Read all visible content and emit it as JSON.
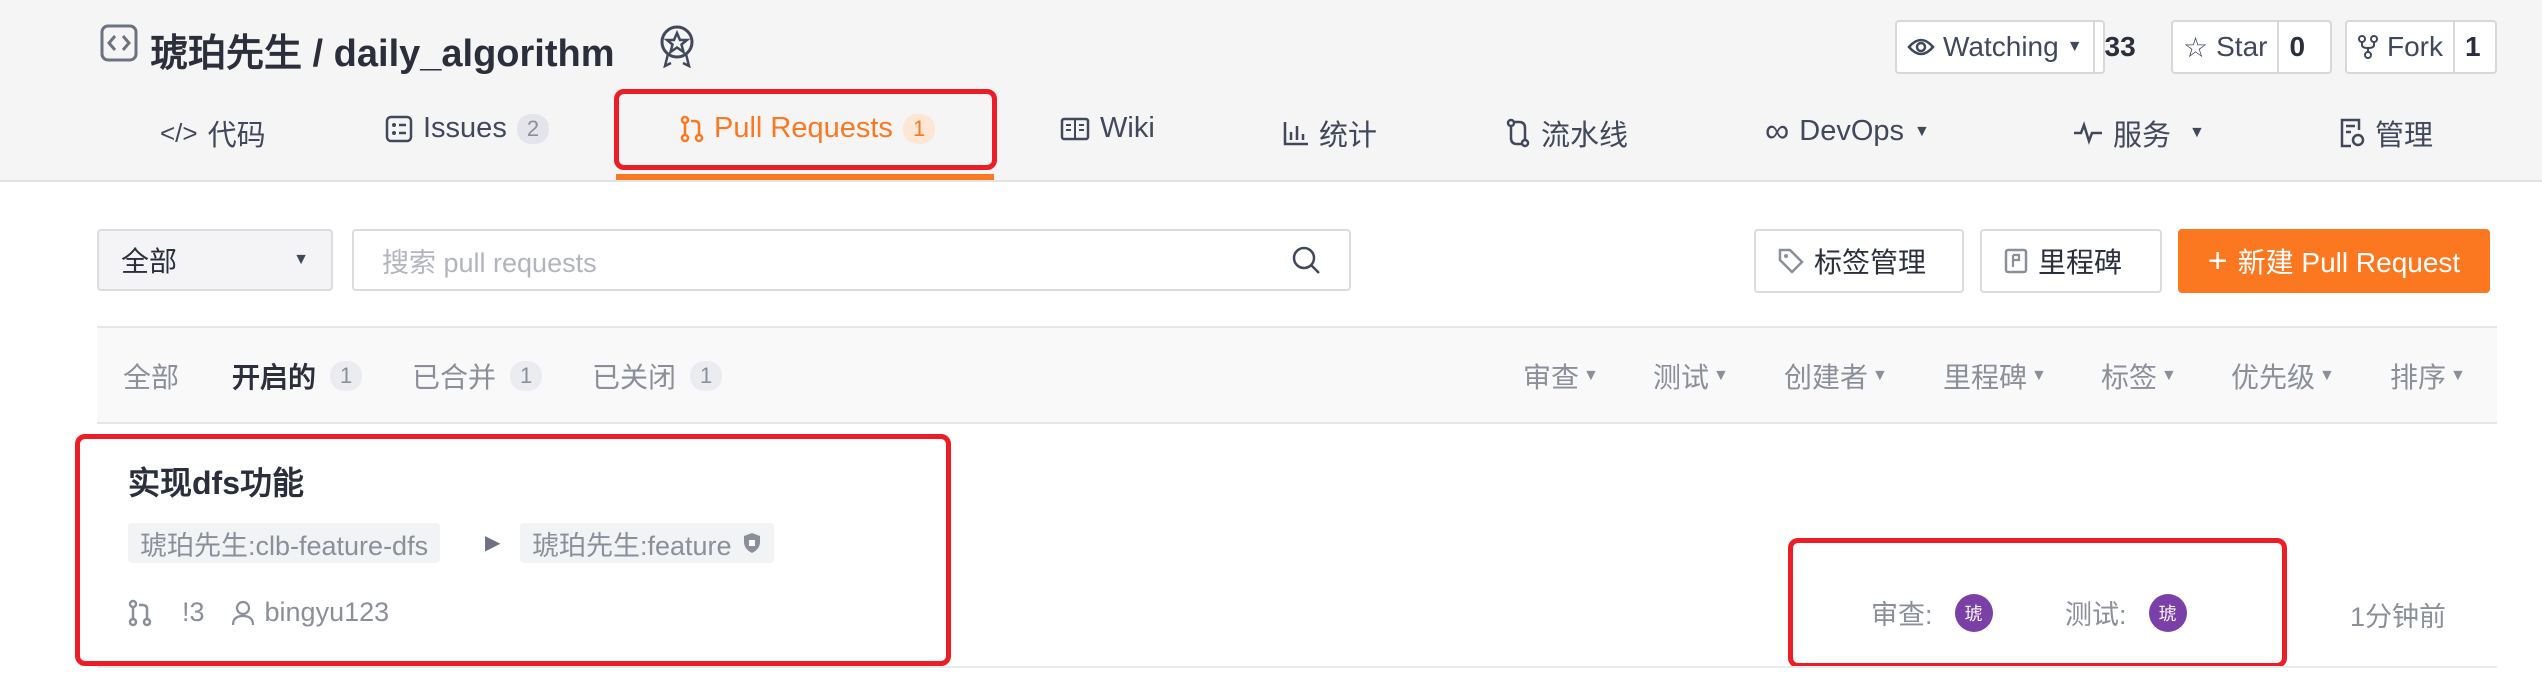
{
  "repo": {
    "title": "琥珀先生 / daily_algorithm",
    "watch": {
      "label": "Watching",
      "count": "33"
    },
    "star": {
      "label": "Star",
      "count": "0"
    },
    "fork": {
      "label": "Fork",
      "count": "1"
    }
  },
  "tabs": [
    {
      "label": "代码",
      "icon": "code-icon"
    },
    {
      "label": "Issues",
      "badge": "2",
      "icon": "issues-icon"
    },
    {
      "label": "Pull Requests",
      "badge": "1",
      "icon": "pull-request-icon",
      "active": true
    },
    {
      "label": "Wiki",
      "icon": "wiki-icon"
    },
    {
      "label": "统计",
      "icon": "bar-chart-icon"
    },
    {
      "label": "流水线",
      "icon": "pipeline-icon"
    },
    {
      "label": "DevOps",
      "icon": "infinity-icon"
    },
    {
      "label": "服务",
      "icon": "pulse-icon"
    },
    {
      "label": "管理",
      "icon": "settings-doc-icon"
    }
  ],
  "toolbar": {
    "select_value": "全部",
    "search_placeholder": "搜索 pull requests",
    "label_manage": "标签管理",
    "milestone": "里程碑",
    "new_pr": "新建 Pull Request"
  },
  "filters": {
    "states": [
      {
        "label": "全部"
      },
      {
        "label": "开启的",
        "badge": "1",
        "active": true
      },
      {
        "label": "已合并",
        "badge": "1"
      },
      {
        "label": "已关闭",
        "badge": "1"
      }
    ],
    "dropdowns": [
      "审查",
      "测试",
      "创建者",
      "里程碑",
      "标签",
      "优先级",
      "排序"
    ]
  },
  "pr": {
    "title": "实现dfs功能",
    "source_branch": "琥珀先生:clb-feature-dfs",
    "target_branch": "琥珀先生:feature",
    "number": "!3",
    "author": "bingyu123",
    "review_label": "审查:",
    "test_label": "测试:",
    "reviewer_avatar": "琥",
    "tester_avatar": "琥",
    "time": "1分钟前"
  },
  "colors": {
    "accent": "#fc7820",
    "highlight": "#ec1d24",
    "avatar": "#7b3fa8"
  }
}
